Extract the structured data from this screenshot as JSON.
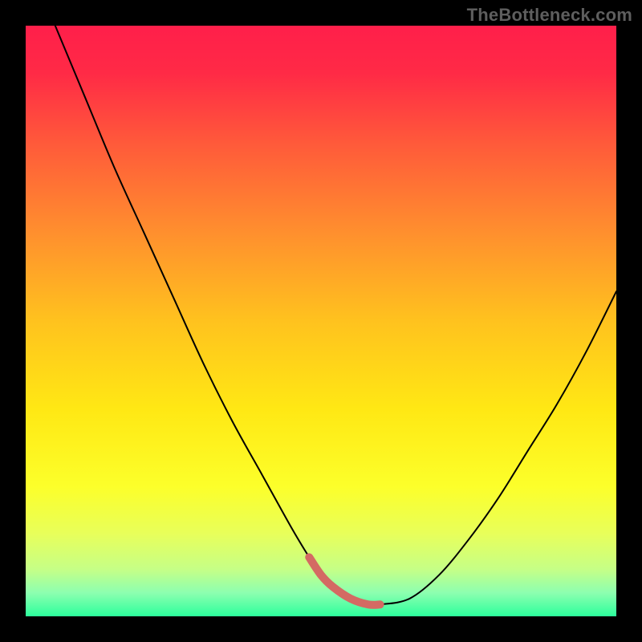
{
  "watermark": "TheBottleneck.com",
  "colors": {
    "gradient_stops": [
      {
        "offset": 0.0,
        "color": "#ff1f4a"
      },
      {
        "offset": 0.08,
        "color": "#ff2a46"
      },
      {
        "offset": 0.2,
        "color": "#ff5a3a"
      },
      {
        "offset": 0.35,
        "color": "#ff8f2e"
      },
      {
        "offset": 0.5,
        "color": "#ffc21e"
      },
      {
        "offset": 0.65,
        "color": "#ffe814"
      },
      {
        "offset": 0.78,
        "color": "#fcff2a"
      },
      {
        "offset": 0.86,
        "color": "#e8ff5a"
      },
      {
        "offset": 0.92,
        "color": "#c6ff86"
      },
      {
        "offset": 0.96,
        "color": "#8dffb0"
      },
      {
        "offset": 1.0,
        "color": "#2cff9c"
      }
    ],
    "curve": "#000000",
    "highlight": "#d46a63"
  },
  "chart_data": {
    "type": "line",
    "title": "",
    "xlabel": "",
    "ylabel": "",
    "xlim": [
      0,
      100
    ],
    "ylim": [
      0,
      100
    ],
    "series": [
      {
        "name": "bottleneck-curve",
        "x": [
          5,
          10,
          15,
          20,
          25,
          30,
          35,
          40,
          45,
          48,
          50,
          52,
          55,
          58,
          60,
          65,
          70,
          75,
          80,
          85,
          90,
          95,
          100
        ],
        "y": [
          100,
          88,
          76,
          65,
          54,
          43,
          33,
          24,
          15,
          10,
          7,
          5,
          3,
          2,
          2,
          3,
          7,
          13,
          20,
          28,
          36,
          45,
          55
        ]
      }
    ],
    "highlight": {
      "name": "optimal-range",
      "x": [
        48,
        50,
        52,
        55,
        58,
        60
      ],
      "y": [
        10,
        7,
        5,
        3,
        2,
        2
      ]
    }
  }
}
